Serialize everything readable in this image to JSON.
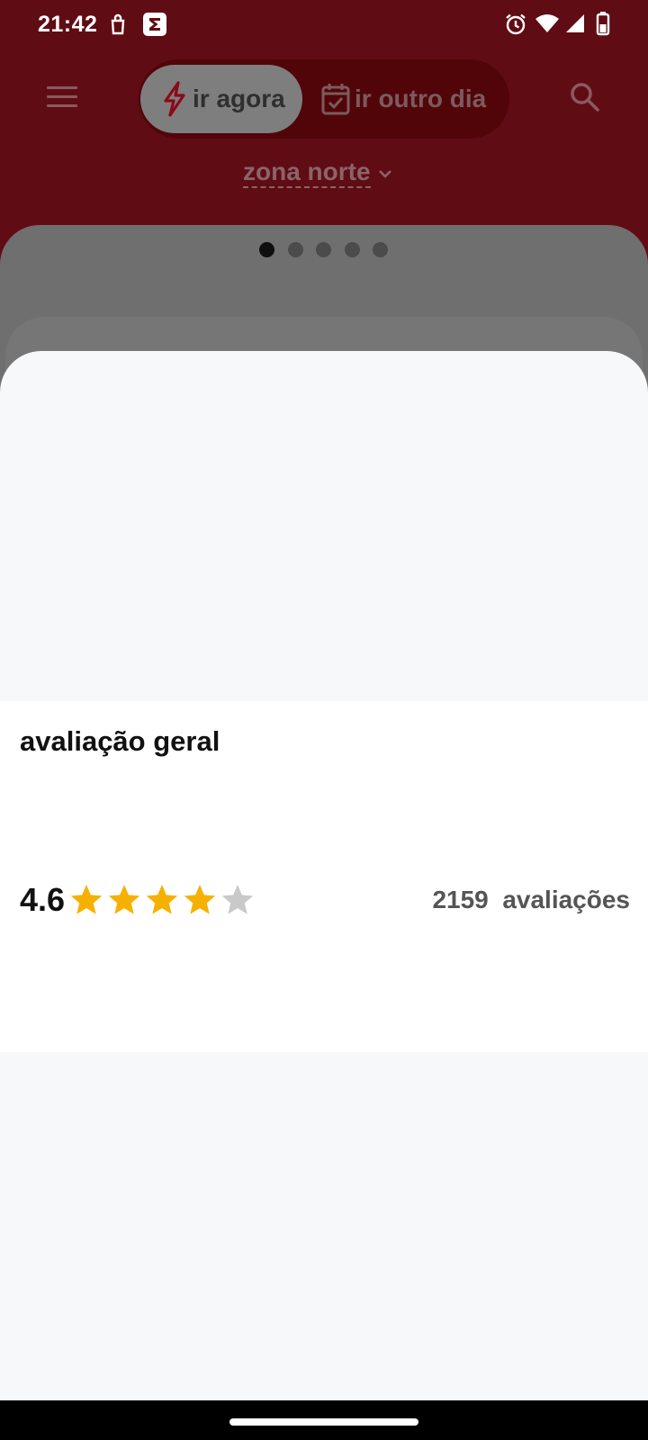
{
  "status_bar": {
    "time": "21:42",
    "left_icons": [
      "bag-icon",
      "sigma-icon"
    ],
    "right_icons": [
      "alarm-icon",
      "wifi-icon",
      "signal-icon",
      "battery-icon"
    ]
  },
  "header": {
    "menu_icon": "menu-icon",
    "mode_toggle": {
      "options": [
        {
          "label": "ir agora",
          "icon": "lightning-icon",
          "selected": true
        },
        {
          "label": "ir outro dia",
          "icon": "calendar-check-icon",
          "selected": false
        }
      ]
    },
    "search_icon": "search-icon",
    "zone": {
      "label": "zona norte",
      "icon": "chevron-down-icon"
    }
  },
  "carousel": {
    "page_count": 5,
    "active_page": 1
  },
  "rating_sheet": {
    "title": "avaliação geral",
    "value": "4.6",
    "stars": {
      "filled": 4,
      "total": 5
    },
    "count_number": "2159",
    "count_label": "avaliações"
  },
  "colors": {
    "header_bg": "#600c14",
    "accent": "#b01020",
    "star_filled": "#f6b100",
    "star_empty": "#c9c9c9",
    "sheet_bg": "#f7f8fa",
    "card_bg": "#ffffff"
  }
}
